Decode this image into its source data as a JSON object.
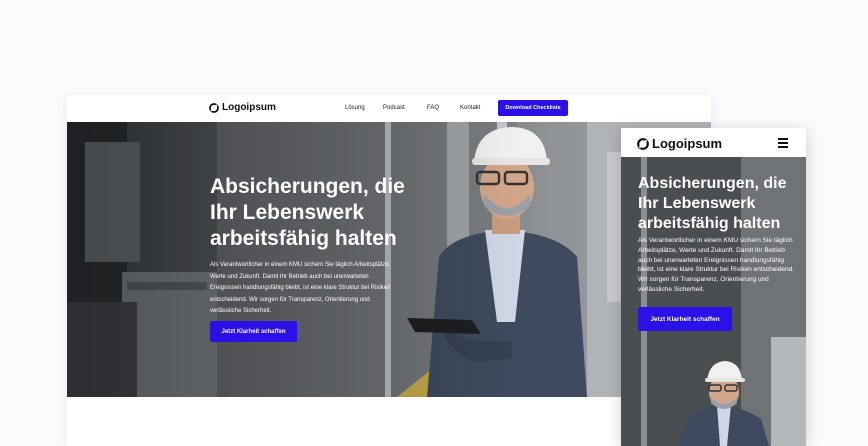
{
  "brand": {
    "name": "Logoipsum"
  },
  "nav": {
    "links": [
      "Lösung",
      "Podcast",
      "FAQ",
      "Kontakt"
    ],
    "cta": "Download Checkliste"
  },
  "hero": {
    "title": "Absicherungen, die Ihr Lebenswerk arbeitsfähig halten",
    "text": "Als Verantwortlicher in einem KMU sichern Sie täglich Arbeitsplätze, Werte und Zukunft. Damit Ihr Betrieb auch bei unerwarteten Ereignissen handlungsfähig bleibt, ist eine klare Struktur bei Risiken entscheidend. Wir sorgen für Transparenz, Orientierung und verlässliche Sicherheit.",
    "button": "Jetzt Klarheit schaffen"
  },
  "colors": {
    "accent": "#2b10e8",
    "text_dark": "#111111",
    "hero_overlay": "#3b3f43"
  },
  "icons": {
    "logo": "logo-icon",
    "menu": "hamburger-menu-icon",
    "tablet": "tablet-icon"
  },
  "photo": {
    "subject": "engineer-in-hard-hat-holding-tablet"
  }
}
